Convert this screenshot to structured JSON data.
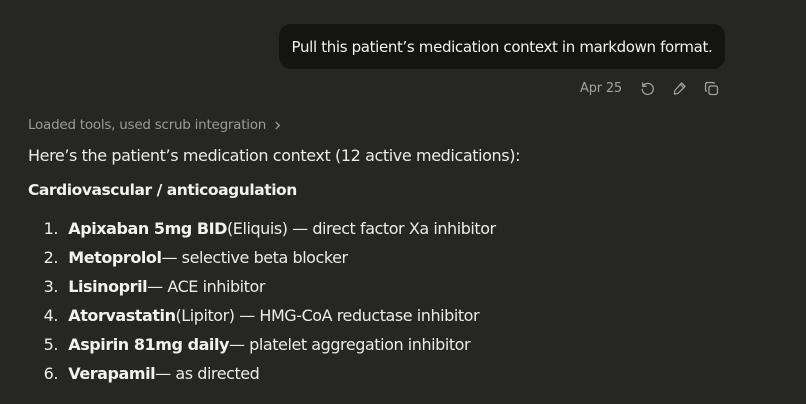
{
  "user_message": {
    "text": "Pull this patient’s medication context in markdown format.",
    "date": "Apr 25",
    "actions": [
      "retry-icon",
      "edit-pencil-icon",
      "copy-icon"
    ]
  },
  "assistant": {
    "tools_line": "Loaded tools, used scrub integration",
    "intro": "Here’s the patient’s medication context (12 active medications):",
    "section_heading": "Cardiovascular / anticoagulation",
    "medications": [
      {
        "num": "1.",
        "name": "Apixaban 5mg BID",
        "rest": " (Eliquis) — direct factor Xa inhibitor"
      },
      {
        "num": "2.",
        "name": "Metoprolol",
        "rest": " — selective beta blocker"
      },
      {
        "num": "3.",
        "name": "Lisinopril",
        "rest": " — ACE inhibitor"
      },
      {
        "num": "4.",
        "name": "Atorvastatin",
        "rest": " (Lipitor) — HMG-CoA reductase inhibitor"
      },
      {
        "num": "5.",
        "name": "Aspirin 81mg daily",
        "rest": " — platelet aggregation inhibitor"
      },
      {
        "num": "6.",
        "name": "Verapamil",
        "rest": " — as directed"
      }
    ]
  },
  "colors": {
    "background": "#262624",
    "user_bubble": "#141413",
    "text": "#ecebe6",
    "muted": "#9c9a94"
  }
}
